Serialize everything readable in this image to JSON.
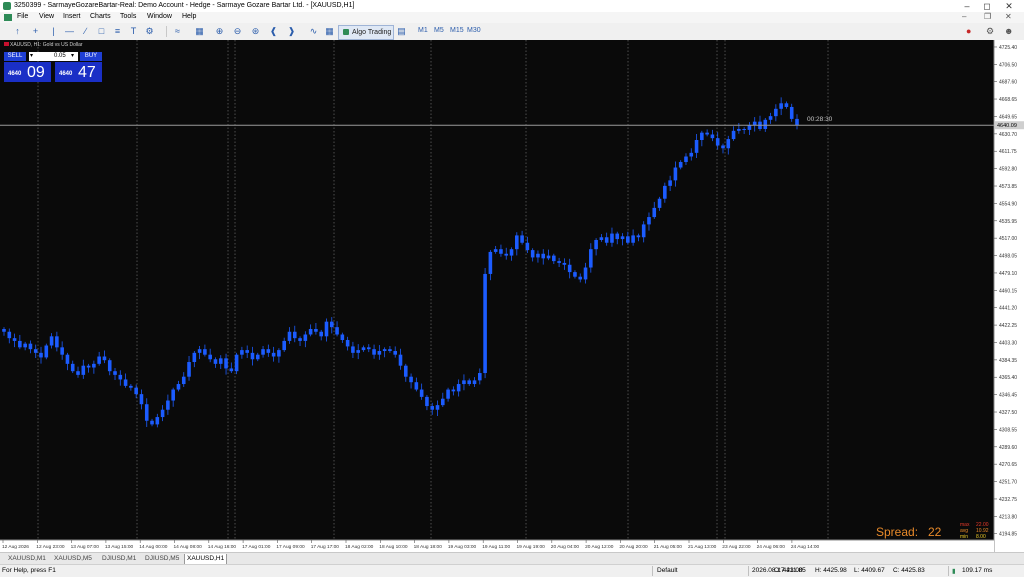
{
  "window": {
    "title": "3250399 - SarmayeGozareBartar-Real: Demo Account - Hedge - Sarmaye Gozare Bartar Ltd. - [XAUUSD,H1]"
  },
  "menu": [
    "File",
    "View",
    "Insert",
    "Charts",
    "Tools",
    "Window",
    "Help"
  ],
  "toolbar": {
    "algo_label": "Algo Trading",
    "timeframes": [
      "M1",
      "M5",
      "M15",
      "M30"
    ]
  },
  "chart": {
    "symbol_label": "XAUUSD, H1:  Gold vs US Dollar",
    "lot": "0.05",
    "sell_label": "SELL",
    "buy_label": "BUY",
    "sell_small": "4640",
    "sell_big": "09",
    "buy_small": "4640",
    "buy_big": "47",
    "timer": "00:28:30",
    "current_price_label": "4640.09",
    "spread_label": "Spread:",
    "spread_value": "22",
    "spread_stats": [
      {
        "k": "max",
        "v": "22.00"
      },
      {
        "k": "avg",
        "v": "10.92"
      },
      {
        "k": "min",
        "v": "8.00"
      }
    ],
    "colors": {
      "bg": "#0a0a0a",
      "candle": "#1c5cff",
      "axis_text": "#c8c8c8",
      "spread": "#e88a2a"
    }
  },
  "chart_data": {
    "type": "candlestick",
    "price_axis_ticks": [
      "4725.40",
      "4706.50",
      "4687.60",
      "4668.65",
      "4649.65",
      "4630.70",
      "4611.75",
      "4592.80",
      "4573.85",
      "4554.90",
      "4535.95",
      "4517.00",
      "4498.05",
      "4479.10",
      "4460.15",
      "4441.20",
      "4422.25",
      "4403.30",
      "4384.35",
      "4365.40",
      "4346.45",
      "4327.50",
      "4308.55",
      "4289.60",
      "4270.65",
      "4251.70",
      "4232.75",
      "4213.80",
      "4194.85"
    ],
    "time_axis_labels": [
      "12 Aug 2026",
      "12 Aug 23:00",
      "13 Aug 07:00",
      "13 Aug 15:00",
      "14 Aug 00:00",
      "14 Aug 08:00",
      "14 Aug 16:00",
      "17 Aug 01:00",
      "17 Aug 09:00",
      "17 Aug 17:00",
      "18 Aug 02:00",
      "18 Aug 10:00",
      "18 Aug 18:00",
      "19 Aug 03:00",
      "19 Aug 11:00",
      "19 Aug 19:00",
      "20 Aug 04:00",
      "20 Aug 12:00",
      "20 Aug 20:00",
      "21 Aug 05:00",
      "21 Aug 13:00",
      "23 Aug 22:00",
      "24 Aug 06:00",
      "24 Aug 14:00"
    ],
    "ylim": [
      4188,
      4733
    ],
    "current_price": 4640.09,
    "closes": [
      4415,
      4408,
      4405,
      4398,
      4402,
      4396,
      4392,
      4387,
      4400,
      4410,
      4398,
      4390,
      4380,
      4372,
      4368,
      4378,
      4376,
      4380,
      4388,
      4384,
      4372,
      4368,
      4363,
      4356,
      4354,
      4347,
      4336,
      4318,
      4314,
      4322,
      4330,
      4340,
      4352,
      4358,
      4366,
      4382,
      4392,
      4396,
      4390,
      4385,
      4380,
      4386,
      4375,
      4372,
      4390,
      4395,
      4392,
      4385,
      4390,
      4396,
      4392,
      4388,
      4395,
      4405,
      4415,
      4408,
      4405,
      4412,
      4418,
      4415,
      4410,
      4426,
      4420,
      4412,
      4406,
      4399,
      4392,
      4395,
      4398,
      4396,
      4390,
      4394,
      4396,
      4394,
      4390,
      4378,
      4366,
      4360,
      4352,
      4344,
      4334,
      4330,
      4335,
      4342,
      4352,
      4350,
      4358,
      4362,
      4358,
      4362,
      4370,
      4478,
      4502,
      4505,
      4500,
      4498,
      4505,
      4520,
      4512,
      4504,
      4496,
      4500,
      4495,
      4498,
      4492,
      4490,
      4488,
      4480,
      4475,
      4472,
      4485,
      4505,
      4515,
      4518,
      4512,
      4522,
      4516,
      4519,
      4512,
      4520,
      4518,
      4532,
      4540,
      4550,
      4560,
      4574,
      4580,
      4594,
      4600,
      4606,
      4610,
      4624,
      4632,
      4630,
      4626,
      4618,
      4615,
      4625,
      4634,
      4636,
      4635,
      4640,
      4644,
      4636,
      4646,
      4650,
      4658,
      4664,
      4660,
      4647,
      4640
    ]
  },
  "tabs": [
    "XAUUSD,M1",
    "XAUUSD,M5",
    "DJIUSD,M1",
    "DJIUSD,M5",
    "XAUUSD,H1"
  ],
  "status": {
    "help": "For Help, press F1",
    "profile": "Default",
    "datetime": "2026.08.17 23:00",
    "open": "O: 4411.85",
    "high": "H: 4425.98",
    "low": "L: 4409.67",
    "close": "C: 4425.83",
    "latency": "109.17 ms"
  }
}
